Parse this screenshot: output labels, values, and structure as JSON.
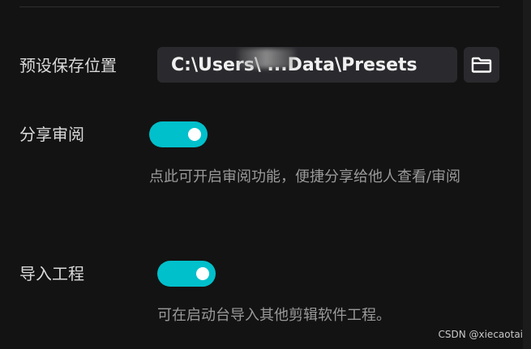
{
  "preset_save_location": {
    "label": "预设保存位置",
    "path_value": "C:\\Users\\      ...Data\\Presets",
    "browse_icon": "folder-icon"
  },
  "share_review": {
    "label": "分享审阅",
    "enabled": true,
    "description": "点此可开启审阅功能，便捷分享给他人查看/审阅"
  },
  "import_project": {
    "label": "导入工程",
    "enabled": true,
    "description": "可在启动台导入其他剪辑软件工程。"
  },
  "colors": {
    "background": "#131313",
    "toggle_on": "#00c0cb",
    "field_background": "#2a2a2e"
  },
  "watermark": "CSDN @xiecaotai"
}
